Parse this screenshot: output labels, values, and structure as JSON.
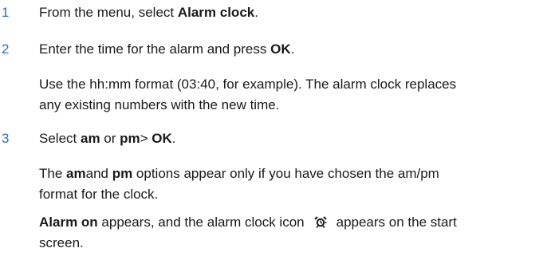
{
  "steps": [
    {
      "number": "1",
      "pre": "From the menu, select ",
      "bold": "Alarm clock",
      "post": "."
    },
    {
      "number": "2",
      "pre": "Enter the time for the alarm and press ",
      "bold": "OK",
      "post": ".",
      "note_line1": "Use the hh:mm format (03:40, for example). The alarm clock replaces",
      "note_line2": "any existing numbers with the new time."
    },
    {
      "number": "3",
      "pre": "Select ",
      "bold1": "am",
      "mid": " or ",
      "bold2": "pm",
      "sep": "> ",
      "bold3": "OK",
      "post": ".",
      "note_pre": "The ",
      "note_bold1": "am",
      "note_mid": "and ",
      "note_bold2": "pm",
      "note_post_line1": " options appear only if you have chosen the am/pm",
      "note_line2": "format for the clock.",
      "final_bold": "Alarm on",
      "final_pre_icon": " appears, and the alarm clock icon",
      "final_post_icon": "appears on the start",
      "final_line2": "screen."
    }
  ],
  "icons": {
    "alarm": "alarm-clock-icon"
  },
  "colors": {
    "step_number": "#2f6fb5",
    "text": "#1a1a1a"
  }
}
